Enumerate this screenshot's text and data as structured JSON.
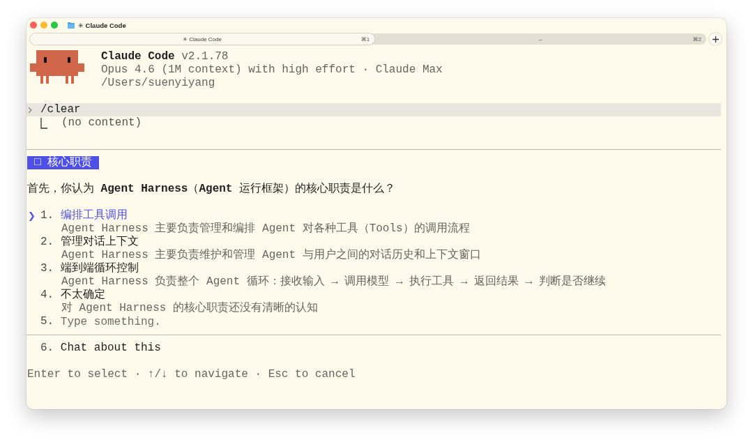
{
  "window": {
    "title": "✳ Claude Code"
  },
  "tabs": [
    {
      "label": "✳ Claude Code",
      "shortcut": "⌘1",
      "selected": true
    },
    {
      "label": "–",
      "shortcut": "⌘2",
      "selected": false
    }
  ],
  "header": {
    "app_name": "Claude Code",
    "version": "v2.1.78",
    "model_line": "Opus 4.6 (1M context) with high effort · Claude Max",
    "path": "/Users/suenyiyang"
  },
  "command": {
    "text": "/clear",
    "output": "(no content)"
  },
  "question": {
    "tag": "□ 核心职责",
    "text": "首先，你认为 **Agent Harness**（**Agent** 运行框架）的核心职责是什么？",
    "cursor": "❯",
    "options": [
      {
        "kind": "choice",
        "number": "1.",
        "label": "编排工具调用",
        "description": "Agent Harness 主要负责管理和编排 Agent 对各种工具（Tools）的调用流程",
        "selected": true
      },
      {
        "kind": "choice",
        "number": "2.",
        "label": "管理对话上下文",
        "description": "Agent Harness 主要负责维护和管理 Agent 与用户之间的对话历史和上下文窗口",
        "selected": false
      },
      {
        "kind": "choice",
        "number": "3.",
        "label": "端到端循环控制",
        "description": "Agent Harness 负责整个 Agent 循环：接收输入 → 调用模型 → 执行工具 → 返回结果 → 判断是否继续",
        "selected": false
      },
      {
        "kind": "choice",
        "number": "4.",
        "label": "不太确定",
        "description": "对 Agent Harness 的核心职责还没有清晰的认知",
        "selected": false
      },
      {
        "kind": "input",
        "number": "5.",
        "placeholder": "Type something.",
        "selected": false
      }
    ],
    "extra_options": [
      {
        "kind": "choice",
        "number": "6.",
        "label": "Chat about this",
        "selected": false
      }
    ]
  },
  "footer": {
    "hint": "Enter to select · ↑/↓ to navigate · Esc to cancel"
  }
}
